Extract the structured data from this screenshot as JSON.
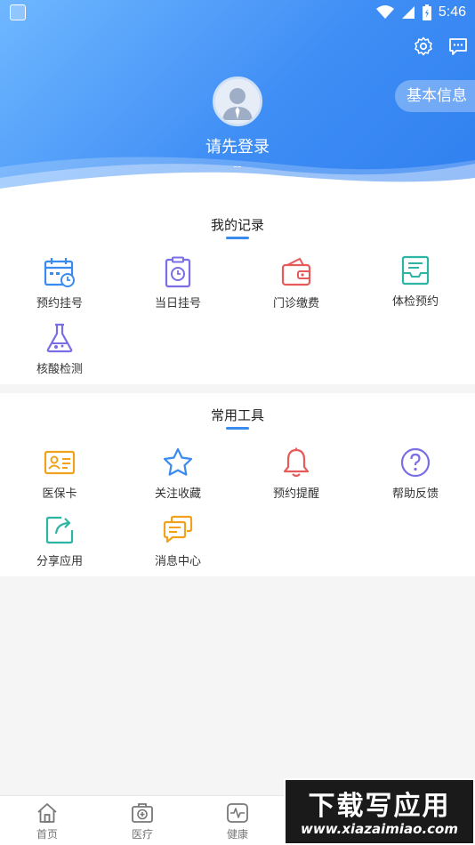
{
  "status_bar": {
    "time": "5:46"
  },
  "header": {
    "info_button": "基本信息",
    "login_prompt": "请先登录",
    "login_sub": "--"
  },
  "records": {
    "title": "我的记录",
    "items": [
      {
        "label": "预约挂号",
        "icon": "calendar-clock-icon"
      },
      {
        "label": "当日挂号",
        "icon": "clipboard-clock-icon"
      },
      {
        "label": "门诊缴费",
        "icon": "wallet-icon"
      },
      {
        "label": "体检预约",
        "icon": "tray-document-icon"
      },
      {
        "label": "核酸检测",
        "icon": "flask-icon"
      }
    ]
  },
  "tools": {
    "title": "常用工具",
    "items": [
      {
        "label": "医保卡",
        "icon": "id-card-icon"
      },
      {
        "label": "关注收藏",
        "icon": "star-icon"
      },
      {
        "label": "预约提醒",
        "icon": "bell-icon"
      },
      {
        "label": "帮助反馈",
        "icon": "question-icon"
      },
      {
        "label": "分享应用",
        "icon": "share-icon"
      },
      {
        "label": "消息中心",
        "icon": "chat-bubbles-icon"
      }
    ]
  },
  "tabbar": {
    "tabs": [
      {
        "label": "首页",
        "icon": "home-icon"
      },
      {
        "label": "医疗",
        "icon": "medical-kit-icon"
      },
      {
        "label": "健康",
        "icon": "heartbeat-icon"
      }
    ]
  },
  "watermark": {
    "title": "下载写应用",
    "url": "www.xiazaimiao.com"
  },
  "colors": {
    "primary": "#3a8bf0",
    "hero_start": "#6fb7ff",
    "hero_end": "#2f7ff0"
  }
}
